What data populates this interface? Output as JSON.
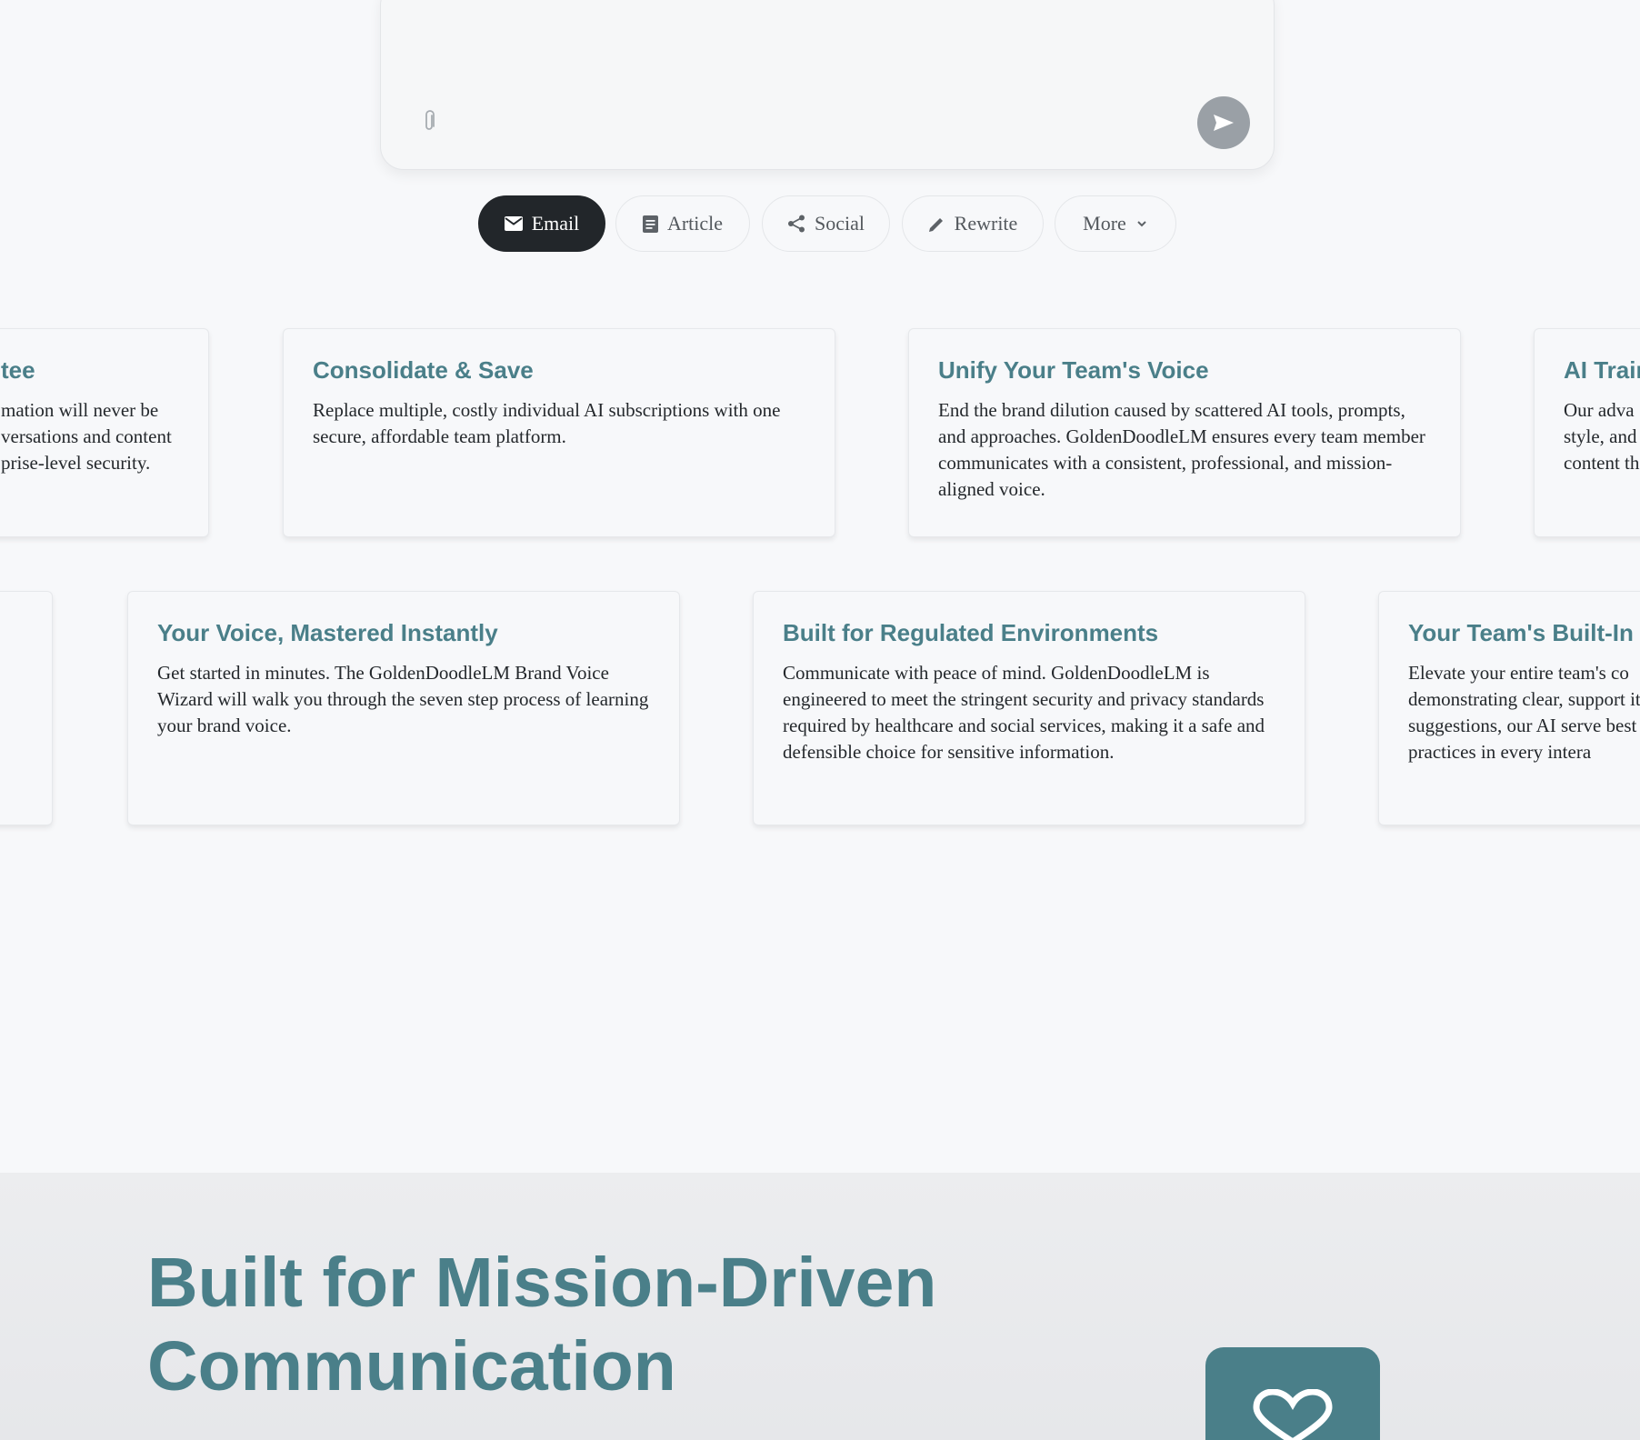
{
  "composer": {
    "attach_icon": "paperclip-icon",
    "send_icon": "send-arrow-icon"
  },
  "chips": [
    {
      "label": "Email",
      "icon": "mail-icon",
      "active": true
    },
    {
      "label": "Article",
      "icon": "document-icon",
      "active": false
    },
    {
      "label": "Social",
      "icon": "share-icon",
      "active": false
    },
    {
      "label": "Rewrite",
      "icon": "pencil-icon",
      "active": false
    },
    {
      "label": "More",
      "icon": "chevron-down-icon",
      "active": false
    }
  ],
  "cards_row1": [
    {
      "title": "tee",
      "body": "mation will never be versations and content prise-level security."
    },
    {
      "title": "Consolidate & Save",
      "body": "Replace multiple, costly individual AI subscriptions with one secure, affordable team platform."
    },
    {
      "title": "Unify Your Team's Voice",
      "body": "End the brand dilution caused by scattered AI tools, prompts, and approaches. GoldenDoodleLM ensures every team member communicates with a consistent, professional, and mission-aligned voice."
    },
    {
      "title": "AI Train",
      "body": "Our adva style, and content th"
    }
  ],
  "cards_row2": [
    {
      "title": "",
      "body": ""
    },
    {
      "title": "Your Voice, Mastered Instantly",
      "body": "Get started in minutes. The GoldenDoodleLM Brand Voice Wizard will walk you through the seven step process of learning your brand voice."
    },
    {
      "title": "Built for Regulated Environments",
      "body": "Communicate with peace of mind. GoldenDoodleLM is engineered to meet the stringent security and privacy standards required by healthcare and social services, making it a safe and defensible choice for sensitive information."
    },
    {
      "title": "Your Team's Built-In C",
      "body": "Elevate your entire team's co demonstrating clear, support its suggestions, our AI serve best practices in every intera"
    }
  ],
  "mission": {
    "title": "Built for Mission-Driven Communication",
    "badge_icon": "heart-icon"
  },
  "colors": {
    "accent": "#4a7f89",
    "chip_active_bg": "#22262a",
    "send_button": "#9aa0a6"
  }
}
